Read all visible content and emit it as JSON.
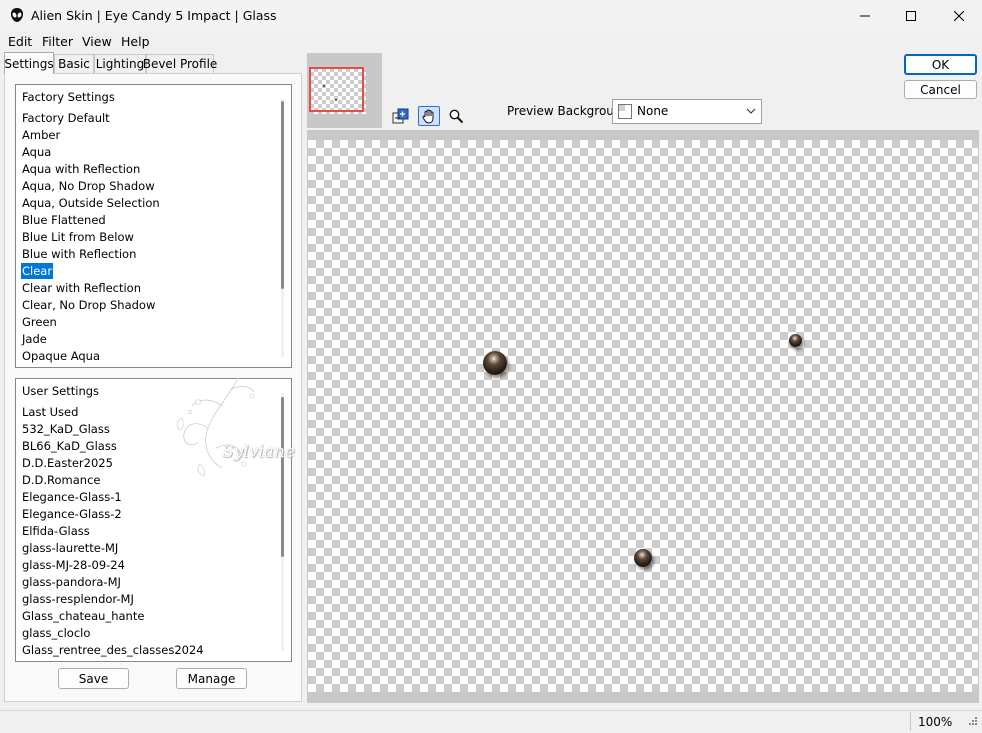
{
  "window": {
    "title": "Alien Skin | Eye Candy 5 Impact | Glass"
  },
  "menu": {
    "items": [
      "Edit",
      "Filter",
      "View",
      "Help"
    ]
  },
  "tabs": [
    "Settings",
    "Basic",
    "Lighting",
    "Bevel Profile"
  ],
  "factory_settings": {
    "header": "Factory Settings",
    "items": [
      "Factory Default",
      "Amber",
      "Aqua",
      "Aqua with Reflection",
      "Aqua, No Drop Shadow",
      "Aqua, Outside Selection",
      "Blue Flattened",
      "Blue Lit from Below",
      "Blue with Reflection",
      "Clear",
      "Clear with Reflection",
      "Clear, No Drop Shadow",
      "Green",
      "Jade",
      "Opaque Aqua"
    ],
    "selected": "Clear"
  },
  "user_settings": {
    "header": "User Settings",
    "items": [
      "Last Used",
      "532_KaD_Glass",
      "BL66_KaD_Glass",
      "D.D.Easter2025",
      "D.D.Romance",
      "Elegance-Glass-1",
      "Elegance-Glass-2",
      "Elfida-Glass",
      "glass-laurette-MJ",
      "glass-MJ-28-09-24",
      "glass-pandora-MJ",
      "glass-resplendor-MJ",
      "Glass_chateau_hante",
      "glass_cloclo",
      "Glass_rentree_des_classes2024"
    ]
  },
  "buttons": {
    "save": "Save",
    "manage": "Manage",
    "ok": "OK",
    "cancel": "Cancel"
  },
  "preview_background": {
    "label": "Preview Background:",
    "value": "None"
  },
  "status": {
    "zoom": "100%"
  },
  "watermark": {
    "text": "Sylviane"
  },
  "colors": {
    "selection": "#0078d7",
    "default_button_border": "#0067c0",
    "navigator_frame": "#e84a4a"
  }
}
